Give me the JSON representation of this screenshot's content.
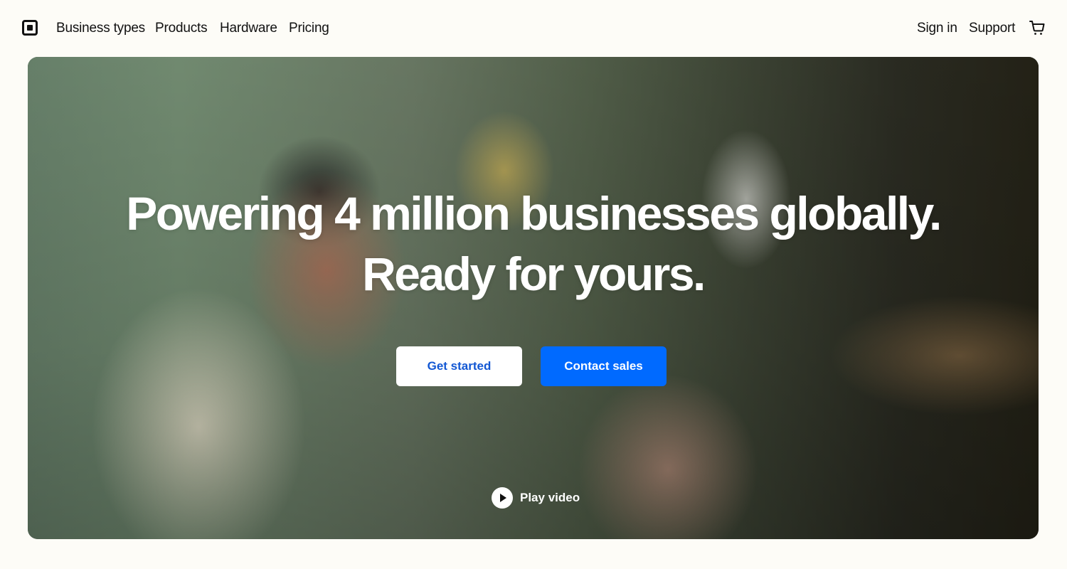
{
  "brand": {
    "logo_icon": "square-logo-icon"
  },
  "nav": {
    "links": [
      {
        "label": "Business types"
      },
      {
        "label": "Products"
      },
      {
        "label": "Hardware"
      },
      {
        "label": "Pricing"
      }
    ],
    "right_links": [
      {
        "label": "Sign in"
      },
      {
        "label": "Support"
      }
    ],
    "cart_icon": "cart-icon"
  },
  "hero": {
    "headline_line1": "Powering 4 million businesses globally.",
    "headline_line2": "Ready for yours.",
    "primary_button": "Get started",
    "secondary_button": "Contact sales",
    "play_label": "Play video",
    "play_icon": "play-icon"
  },
  "colors": {
    "page_background": "#fdfcf7",
    "primary_button_bg": "#ffffff",
    "primary_button_text": "#1257d3",
    "secondary_button_bg": "#006aff",
    "secondary_button_text": "#ffffff",
    "text": "#111111"
  }
}
